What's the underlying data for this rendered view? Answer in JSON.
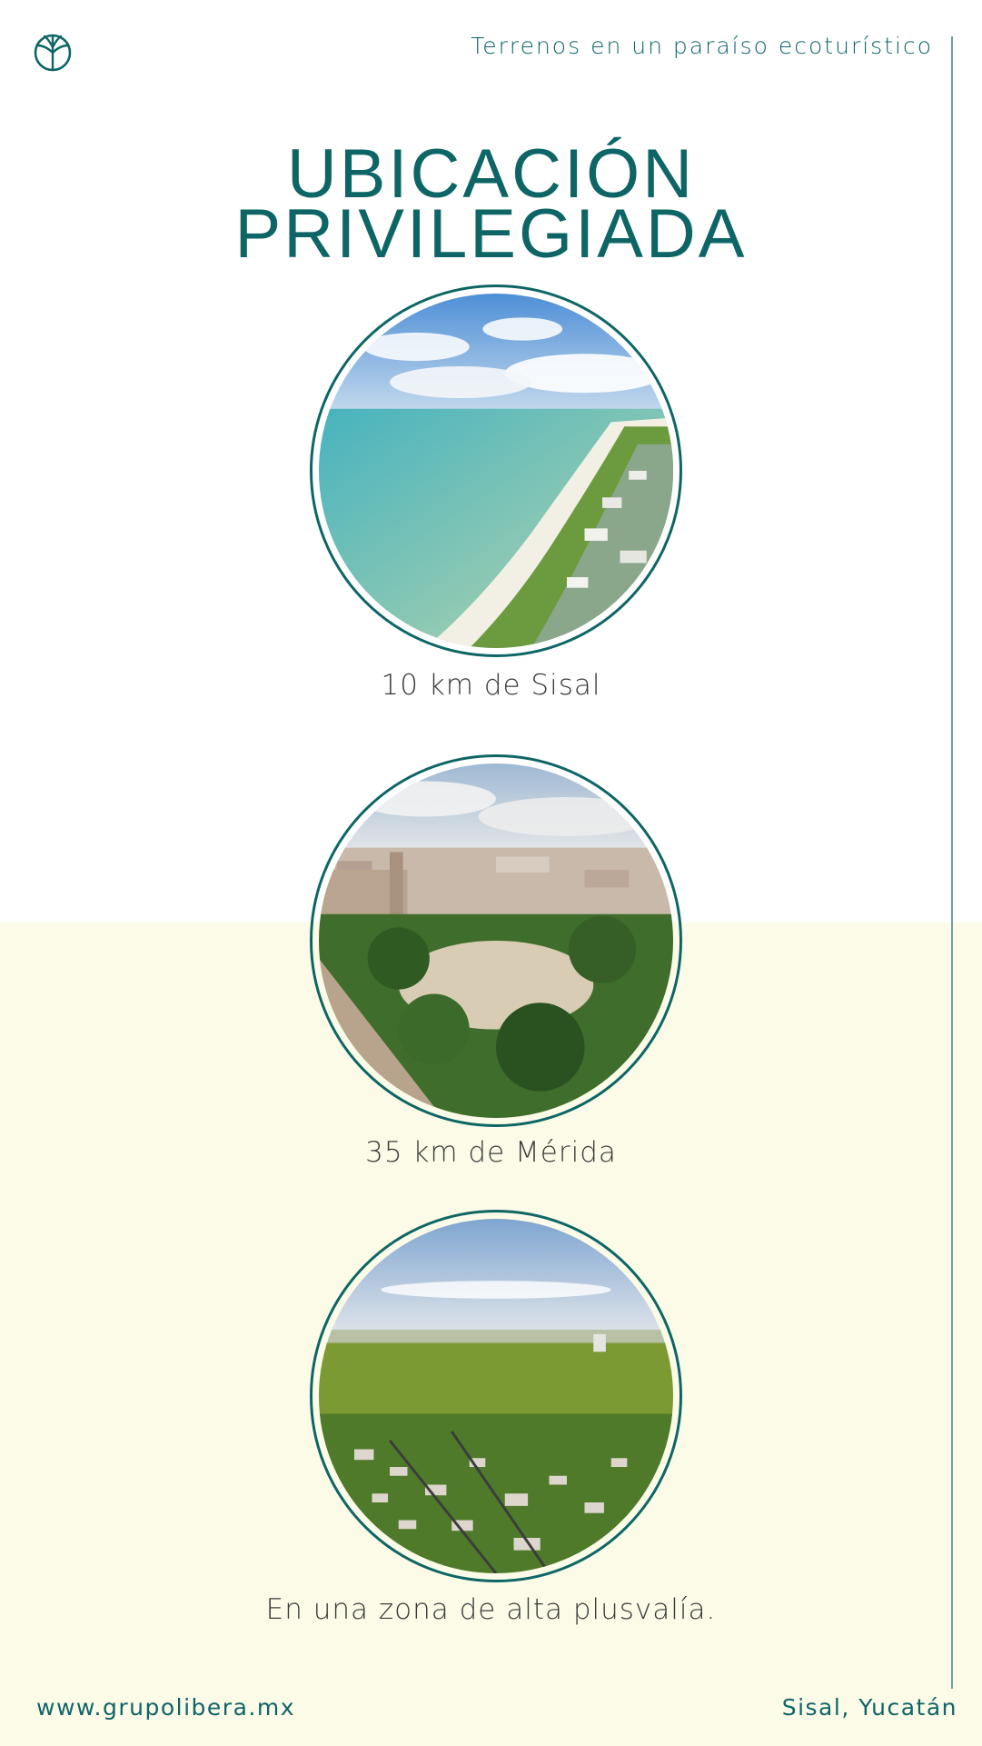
{
  "header": {
    "logo_icon": "tree-circle-icon",
    "tagline": "Terrenos en un paraíso ecoturístico",
    "title_line1": "UBICACIÓN",
    "title_line2": "PRIVILEGIADA"
  },
  "locations": [
    {
      "caption": "10 km de Sisal",
      "image": "beach-aerial-photo"
    },
    {
      "caption": "35 km de Mérida",
      "image": "city-plaza-aerial-photo"
    },
    {
      "caption": "En una zona de alta plusvalía.",
      "image": "suburb-aerial-photo"
    }
  ],
  "footer": {
    "website": "www.grupolibera.mx",
    "place": "Sisal, Yucatán"
  },
  "colors": {
    "brand_teal": "#0d6665",
    "cream_background": "#fcfbe7"
  }
}
